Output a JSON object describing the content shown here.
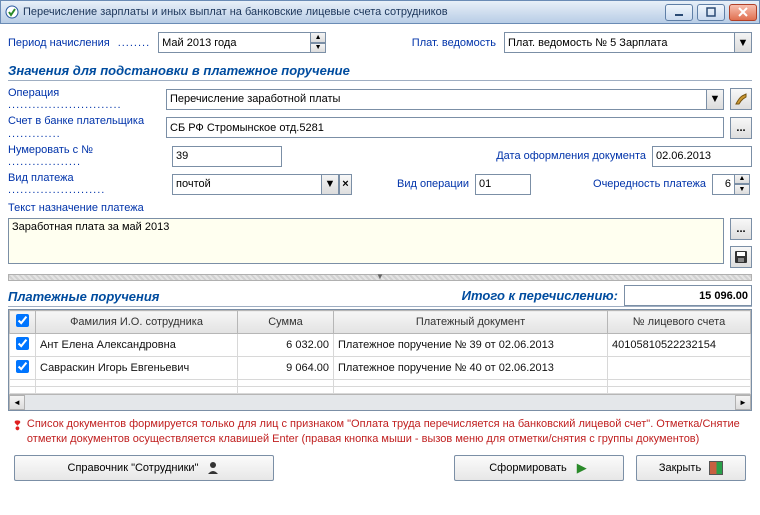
{
  "window": {
    "title": "Перечисление зарплаты и иных выплат на банковские лицевые счета сотрудников"
  },
  "top": {
    "period_label": "Период начисления",
    "period_value": "Май 2013 года",
    "ledger_label": "Плат. ведомость",
    "ledger_value": "Плат. ведомость № 5 Зарплата"
  },
  "subhead1": "Значения для подстановки в платежное поручение",
  "operation": {
    "label": "Операция",
    "value": "Перечисление заработной платы"
  },
  "bank": {
    "label": "Счет в банке плательщика",
    "value": "СБ РФ Стромынское отд.5281",
    "ellipsis": "..."
  },
  "num_from": {
    "label": "Нумеровать с №",
    "value": "39"
  },
  "doc_date": {
    "label": "Дата оформления документа",
    "value": "02.06.2013"
  },
  "pay_kind": {
    "label": "Вид платежа",
    "value": "почтой",
    "x": "×"
  },
  "op_kind": {
    "label": "Вид операции",
    "value": "01"
  },
  "priority": {
    "label": "Очередность платежа",
    "value": "6"
  },
  "memo": {
    "label": "Текст назначение платежа",
    "value": "Заработная плата за май 2013"
  },
  "pp": {
    "title": "Платежные поручения",
    "total_label": "Итого к перечислению:",
    "total_value": "15 096.00",
    "cols": {
      "fio": "Фамилия И.О. сотрудника",
      "sum": "Сумма",
      "doc": "Платежный документ",
      "acct": "№ лицевого счета"
    },
    "rows": [
      {
        "checked": true,
        "fio": "Ант Елена Александровна",
        "sum": "6 032.00",
        "doc": "Платежное поручение № 39 от 02.06.2013",
        "acct": "40105810522232154"
      },
      {
        "checked": true,
        "fio": "Савраскин Игорь Евгеньевич",
        "sum": "9 064.00",
        "doc": "Платежное поручение № 40 от 02.06.2013",
        "acct": ""
      }
    ]
  },
  "hint": "Список документов формируется только для лиц с признаком \"Оплата труда перечисляется на банковский лицевой счет\". Отметка/Снятие отметки документов осуществляется клавишей Enter (правая кнопка мыши - вызов меню для отметки/снятия с группы документов)",
  "buttons": {
    "ref": "Справочник \"Сотрудники\"",
    "form": "Сформировать",
    "close": "Закрыть"
  }
}
